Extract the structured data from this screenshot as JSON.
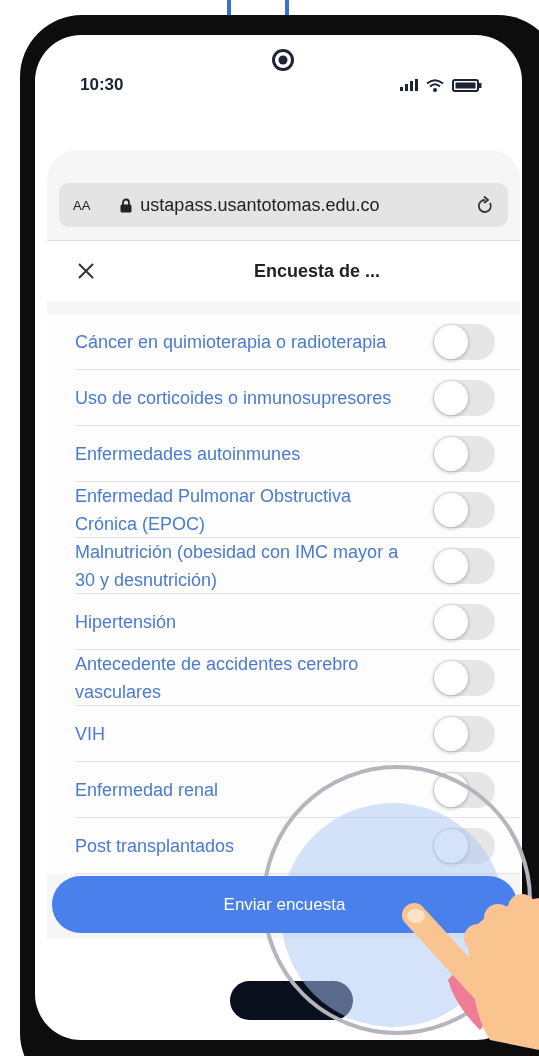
{
  "status_bar": {
    "time": "10:30"
  },
  "browser": {
    "text_size_button": "AA",
    "url": "ustapass.usantotomas.edu.co"
  },
  "header": {
    "title": "Encuesta de ..."
  },
  "conditions": [
    {
      "label": "Cáncer en quimioterapia o radioterapia",
      "on": false
    },
    {
      "label": "Uso de corticoides o inmunosupresores",
      "on": false
    },
    {
      "label": "Enfermedades autoinmunes",
      "on": false
    },
    {
      "label": "Enfermedad Pulmonar Obstructiva Crónica (EPOC)",
      "on": false
    },
    {
      "label": "Malnutrición (obesidad con IMC mayor a 30 y desnutrición)",
      "on": false
    },
    {
      "label": "Hipertensión",
      "on": false
    },
    {
      "label": "Antecedente de accidentes cerebro vasculares",
      "on": false
    },
    {
      "label": "VIH",
      "on": false
    },
    {
      "label": "Enfermedad renal",
      "on": false
    },
    {
      "label": "Post transplantados",
      "on": false
    }
  ],
  "submit_button": "Enviar encuesta"
}
